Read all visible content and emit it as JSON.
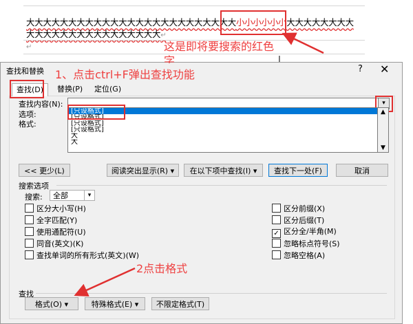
{
  "document": {
    "line1_pre": "大大大大大大大大大大大大大大大大大大大大大大大大大",
    "line1_red": "小小小小小小",
    "line1_post": "大大大大大大大大",
    "line2": "大大大大大大大大大大大大大大大大",
    "para_mark": "↵",
    "cursor": "I"
  },
  "annotations": {
    "red_text_note_line1": "这是即将要搜索的红色",
    "red_text_note_line2": "字",
    "step1": "1、点击ctrl+F弹出查找功能",
    "step2": "2点击格式"
  },
  "dialog": {
    "title": "查找和替换",
    "help": "?",
    "close": "✕",
    "tabs": [
      {
        "label": "查找(D)",
        "active": true
      },
      {
        "label": "替换(P)",
        "active": false
      },
      {
        "label": "定位(G)",
        "active": false
      }
    ],
    "find_label": "查找内容(N):",
    "options_label": "选项:",
    "format_label": "格式:",
    "find_value": "",
    "dropdown_items": [
      "[只设格式]",
      "[只设格式]",
      "[只设格式]",
      "[只设格式]",
      "大",
      "大"
    ],
    "buttons": {
      "less": "<< 更少(L)",
      "reading_highlight": "阅读突出显示(R) ▾",
      "find_in": "在以下项中查找(I) ▾",
      "find_next": "查找下一处(F)",
      "cancel": "取消"
    },
    "search_options_title": "搜索选项",
    "search_label": "搜索:",
    "search_value": "全部",
    "checkboxes_left": [
      {
        "label": "区分大小写(H)",
        "checked": false
      },
      {
        "label": "全字匹配(Y)",
        "checked": false
      },
      {
        "label": "使用通配符(U)",
        "checked": false
      },
      {
        "label": "同音(英文)(K)",
        "checked": false
      },
      {
        "label": "查找单词的所有形式(英文)(W)",
        "checked": false
      }
    ],
    "checkboxes_right": [
      {
        "label": "区分前缀(X)",
        "checked": false
      },
      {
        "label": "区分后缀(T)",
        "checked": false
      },
      {
        "label": "区分全/半角(M)",
        "checked": true
      },
      {
        "label": "忽略标点符号(S)",
        "checked": false
      },
      {
        "label": "忽略空格(A)",
        "checked": false
      }
    ],
    "find_section_title": "查找",
    "bottom_buttons": {
      "format": "格式(O) ▾",
      "special": "特殊格式(E) ▾",
      "no_format": "不限定格式(T)"
    }
  },
  "colors": {
    "annotation_red": "#e03030",
    "selection_blue": "#0078d7",
    "dialog_bg": "#f0f0f0"
  }
}
